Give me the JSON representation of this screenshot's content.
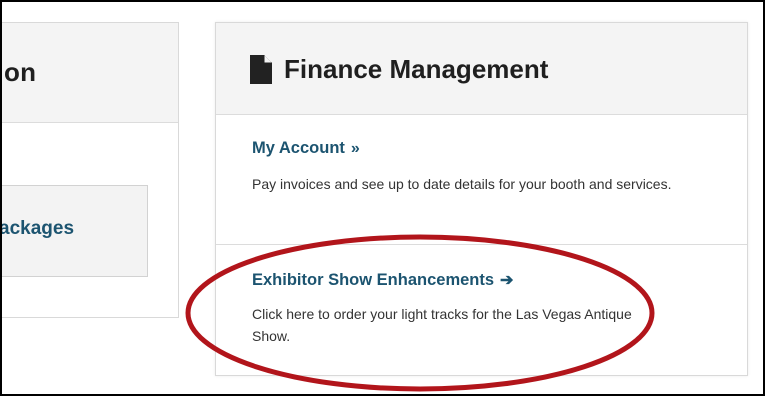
{
  "left_card": {
    "title_fragment": "on",
    "package_label_fragment": "ackages"
  },
  "finance_card": {
    "icon": "document-icon",
    "title": "Finance Management",
    "items": [
      {
        "link_label": "My Account",
        "link_glyph": "»",
        "description": "Pay invoices and see up to date details for your booth and services."
      },
      {
        "link_label": "Exhibitor Show Enhancements",
        "link_glyph": "➔",
        "description_line1": "Click here to order your light tracks for the Las Vegas Antique",
        "description_line2": "Show."
      }
    ]
  },
  "colors": {
    "link": "#1c5470",
    "annotation": "#b2151b",
    "header_bg": "#f4f4f4"
  },
  "annotation": {
    "shape": "ellipse"
  }
}
